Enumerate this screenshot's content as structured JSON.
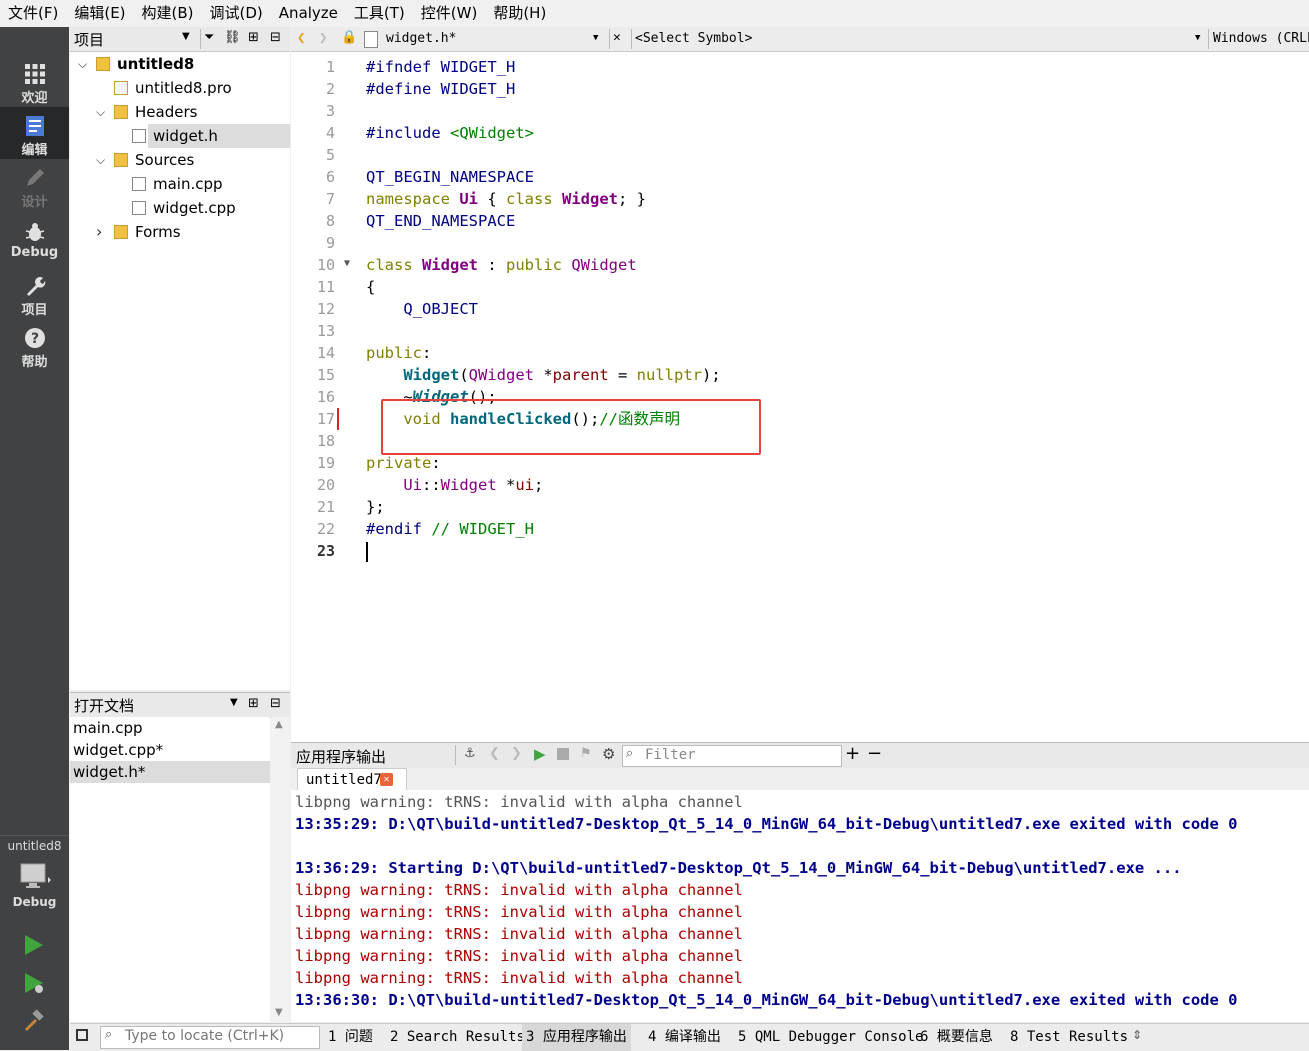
{
  "menu": [
    "文件(F)",
    "编辑(E)",
    "构建(B)",
    "调试(D)",
    "Analyze",
    "工具(T)",
    "控件(W)",
    "帮助(H)"
  ],
  "modes": [
    {
      "label": "欢迎",
      "icon": "grid-icon"
    },
    {
      "label": "编辑",
      "icon": "edit-doc-icon"
    },
    {
      "label": "设计",
      "icon": "pencil-icon"
    },
    {
      "label": "Debug",
      "icon": "bug-icon"
    },
    {
      "label": "项目",
      "icon": "wrench-icon"
    },
    {
      "label": "帮助",
      "icon": "help-icon"
    }
  ],
  "kit": {
    "project": "untitled8",
    "label": "Debug"
  },
  "project_panel": {
    "title": "项目",
    "tree": [
      {
        "label": "untitled8",
        "depth": 0,
        "arrow": "v",
        "icon": "qt-project-icon",
        "bold": true
      },
      {
        "label": "untitled8.pro",
        "depth": 1,
        "arrow": "",
        "icon": "pro-file-icon"
      },
      {
        "label": "Headers",
        "depth": 1,
        "arrow": "v",
        "icon": "header-folder-icon"
      },
      {
        "label": "widget.h",
        "depth": 2,
        "arrow": "",
        "icon": "file-icon",
        "selected": true
      },
      {
        "label": "Sources",
        "depth": 1,
        "arrow": "v",
        "icon": "source-folder-icon"
      },
      {
        "label": "main.cpp",
        "depth": 2,
        "arrow": "",
        "icon": "file-icon"
      },
      {
        "label": "widget.cpp",
        "depth": 2,
        "arrow": "",
        "icon": "file-icon"
      },
      {
        "label": "Forms",
        "depth": 1,
        "arrow": ">",
        "icon": "forms-folder-icon"
      }
    ]
  },
  "open_docs": {
    "title": "打开文档",
    "items": [
      {
        "label": "main.cpp"
      },
      {
        "label": "widget.cpp*"
      },
      {
        "label": "widget.h*",
        "selected": true
      }
    ]
  },
  "editor": {
    "file_tab": "widget.h*",
    "symbol": "<Select Symbol>",
    "encoding": "Windows (CRLF",
    "current_line": "23",
    "lines": [
      {
        "n": "1",
        "tokens": [
          [
            "pp",
            "#ifndef WIDGET_H"
          ]
        ]
      },
      {
        "n": "2",
        "tokens": [
          [
            "pp",
            "#define WIDGET_H"
          ]
        ]
      },
      {
        "n": "3",
        "tokens": []
      },
      {
        "n": "4",
        "tokens": [
          [
            "pp",
            "#include "
          ],
          [
            "str",
            "<QWidget>"
          ]
        ]
      },
      {
        "n": "5",
        "tokens": []
      },
      {
        "n": "6",
        "tokens": [
          [
            "mac",
            "QT_BEGIN_NAMESPACE"
          ]
        ]
      },
      {
        "n": "7",
        "tokens": [
          [
            "kw",
            "namespace "
          ],
          [
            "typ",
            "Ui"
          ],
          [
            "",
            " { "
          ],
          [
            "kw",
            "class "
          ],
          [
            "typ",
            "Widget"
          ],
          [
            "",
            "; }"
          ]
        ]
      },
      {
        "n": "8",
        "tokens": [
          [
            "mac",
            "QT_END_NAMESPACE"
          ]
        ]
      },
      {
        "n": "9",
        "tokens": []
      },
      {
        "n": "10",
        "tokens": [
          [
            "kw",
            "class "
          ],
          [
            "typ",
            "Widget"
          ],
          [
            "",
            " : "
          ],
          [
            "kw",
            "public "
          ],
          [
            "typ2",
            "QWidget"
          ]
        ]
      },
      {
        "n": "11",
        "tokens": [
          [
            "",
            "{"
          ]
        ]
      },
      {
        "n": "12",
        "tokens": [
          [
            "",
            "    "
          ],
          [
            "mac",
            "Q_OBJECT"
          ]
        ]
      },
      {
        "n": "13",
        "tokens": []
      },
      {
        "n": "14",
        "tokens": [
          [
            "kw",
            "public"
          ],
          [
            "",
            ":"
          ]
        ]
      },
      {
        "n": "15",
        "tokens": [
          [
            "",
            "    "
          ],
          [
            "fn",
            "Widget"
          ],
          [
            "",
            "("
          ],
          [
            "typ2",
            "QWidget"
          ],
          [
            "",
            " *"
          ],
          [
            "fld",
            "parent"
          ],
          [
            "",
            " = "
          ],
          [
            "kw",
            "nullptr"
          ],
          [
            "",
            ");"
          ]
        ]
      },
      {
        "n": "16",
        "tokens": [
          [
            "",
            "    ~"
          ],
          [
            "fni",
            "Widget"
          ],
          [
            "",
            "();"
          ]
        ]
      },
      {
        "n": "17",
        "tokens": [
          [
            "",
            "    "
          ],
          [
            "kw",
            "void "
          ],
          [
            "fn",
            "handleClicked"
          ],
          [
            "",
            "();"
          ],
          [
            "cm",
            "//函数声明"
          ]
        ]
      },
      {
        "n": "18",
        "tokens": []
      },
      {
        "n": "19",
        "tokens": [
          [
            "kw",
            "private"
          ],
          [
            "",
            ":"
          ]
        ]
      },
      {
        "n": "20",
        "tokens": [
          [
            "",
            "    "
          ],
          [
            "typ2",
            "Ui"
          ],
          [
            "",
            "::"
          ],
          [
            "typ2",
            "Widget"
          ],
          [
            "",
            " *"
          ],
          [
            "fld",
            "ui"
          ],
          [
            "",
            ";"
          ]
        ]
      },
      {
        "n": "21",
        "tokens": [
          [
            "",
            "};"
          ]
        ]
      },
      {
        "n": "22",
        "tokens": [
          [
            "pp",
            "#endif "
          ],
          [
            "cm",
            "// WIDGET_H"
          ]
        ]
      },
      {
        "n": "23",
        "tokens": []
      }
    ]
  },
  "output": {
    "title": "应用程序输出",
    "filter_placeholder": "Filter",
    "tab": "untitled7",
    "lines": [
      {
        "style": "warn-gray",
        "text": "libpng warning: tRNS: invalid with alpha channel"
      },
      {
        "style": "bold-blue",
        "text": "13:35:29: D:\\QT\\build-untitled7-Desktop_Qt_5_14_0_MinGW_64_bit-Debug\\untitled7.exe exited with code 0"
      },
      {
        "style": "warn-gray",
        "text": ""
      },
      {
        "style": "bold-blue",
        "text": "13:36:29: Starting D:\\QT\\build-untitled7-Desktop_Qt_5_14_0_MinGW_64_bit-Debug\\untitled7.exe ..."
      },
      {
        "style": "warn-red",
        "text": "libpng warning: tRNS: invalid with alpha channel"
      },
      {
        "style": "warn-red",
        "text": "libpng warning: tRNS: invalid with alpha channel"
      },
      {
        "style": "warn-red",
        "text": "libpng warning: tRNS: invalid with alpha channel"
      },
      {
        "style": "warn-red",
        "text": "libpng warning: tRNS: invalid with alpha channel"
      },
      {
        "style": "warn-red",
        "text": "libpng warning: tRNS: invalid with alpha channel"
      },
      {
        "style": "bold-blue",
        "text": "13:36:30: D:\\QT\\build-untitled7-Desktop_Qt_5_14_0_MinGW_64_bit-Debug\\untitled7.exe exited with code 0"
      }
    ]
  },
  "statusbar": {
    "locate_placeholder": "Type to locate (Ctrl+K)",
    "tabs": [
      {
        "label": "1 问题"
      },
      {
        "label": "2 Search Results"
      },
      {
        "label": "3 应用程序输出",
        "active": true
      },
      {
        "label": "4 编译输出"
      },
      {
        "label": "5 QML Debugger Console"
      },
      {
        "label": "6 概要信息"
      },
      {
        "label": "8 Test Results"
      }
    ]
  },
  "colors": {
    "highlight_box": "#e8413b",
    "run_green": "#3fa63f",
    "modebar_bg": "#404244"
  }
}
